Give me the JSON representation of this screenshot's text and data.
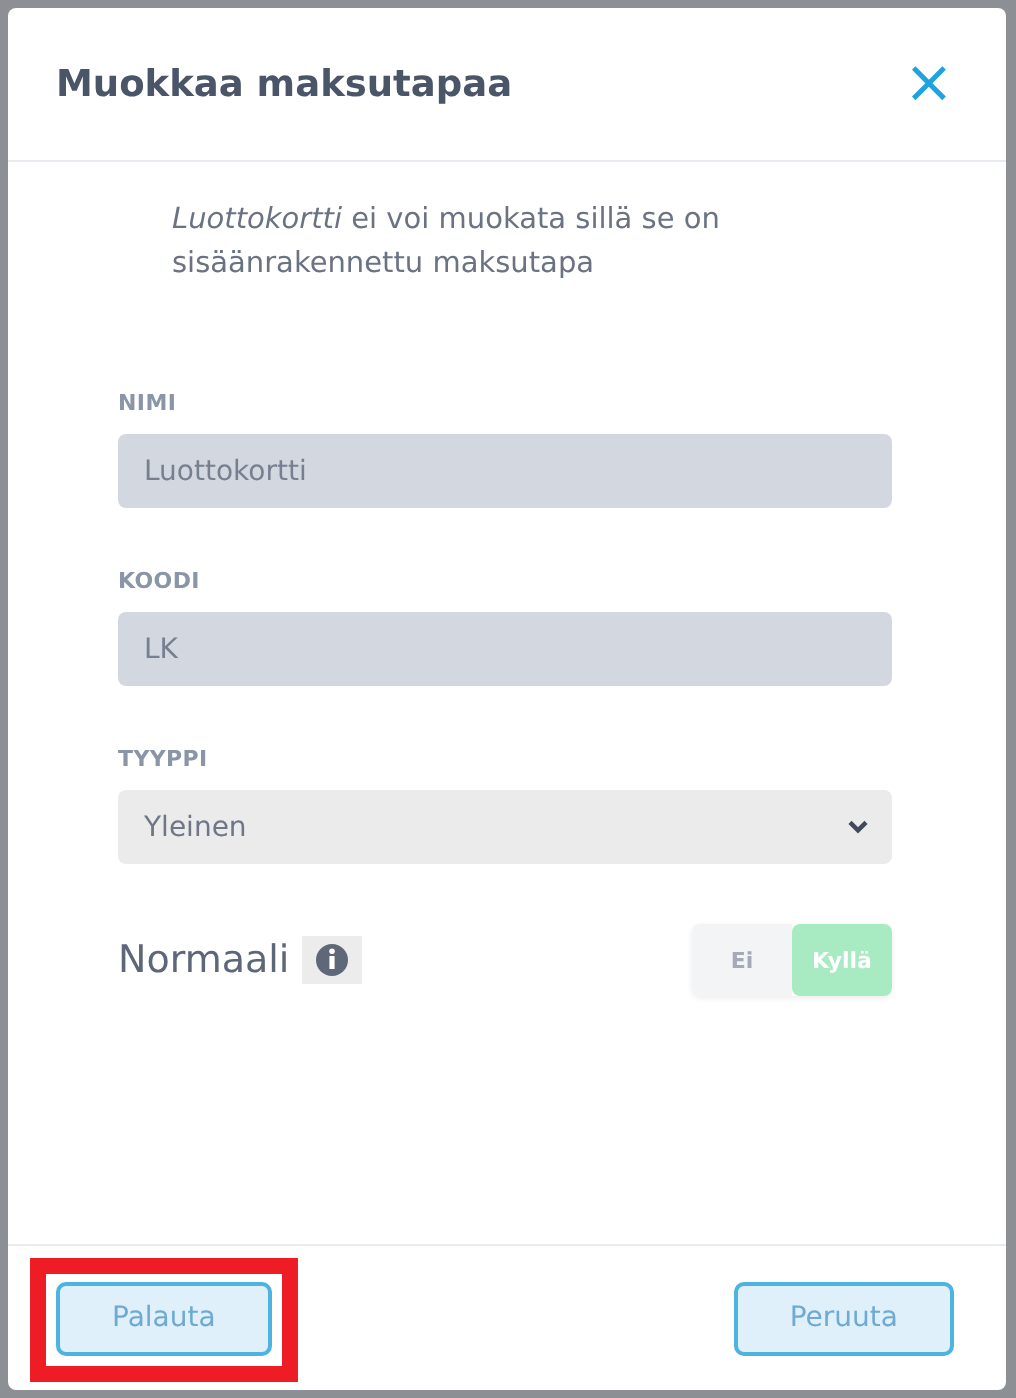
{
  "dialog": {
    "title": "Muokkaa maksutapaa",
    "close": "×"
  },
  "notice": "*Luottokortti* ei voi muokata sillä se on sisäänrakennettu maksutapa",
  "fields": [
    {
      "kind": "text",
      "label": "NIMI",
      "value": "Luottokortti",
      "disabled": true
    },
    {
      "kind": "text",
      "label": "KOODI",
      "value": "LK",
      "disabled": true
    },
    {
      "kind": "select",
      "label": "TYYPPI",
      "value": "Yleinen",
      "disabled": false
    }
  ],
  "toggle": {
    "label": "Normaali",
    "disabled": true,
    "options": [
      {
        "label": "Ei",
        "selected": false
      },
      {
        "label": "Kyllä",
        "selected": true
      }
    ]
  },
  "buttons": [
    {
      "label": "Palauta",
      "highlighted": true
    },
    {
      "label": "Peruuta",
      "highlighted": false
    }
  ]
}
